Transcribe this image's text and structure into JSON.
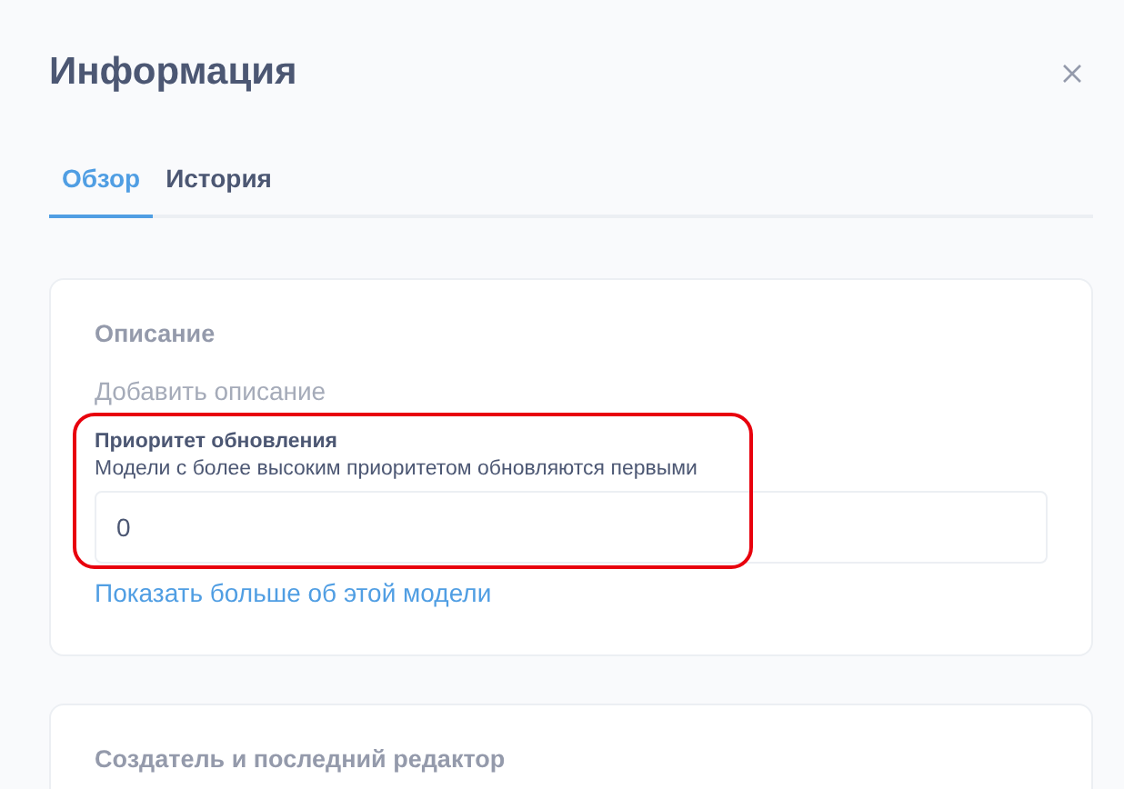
{
  "window": {
    "title": "Информация"
  },
  "tabs": [
    {
      "label": "Обзор",
      "selected": true
    },
    {
      "label": "История",
      "selected": false
    }
  ],
  "description": {
    "heading": "Описание",
    "placeholder": "Добавить описание"
  },
  "update_priority": {
    "label": "Приоритет обновления",
    "hint": "Модели с более высоким приоритетом обновляются первыми",
    "value": "0",
    "highlighted": true
  },
  "more_link": "Показать больше об этой модели",
  "creator_section": {
    "heading": "Создатель и последний редактор"
  }
}
